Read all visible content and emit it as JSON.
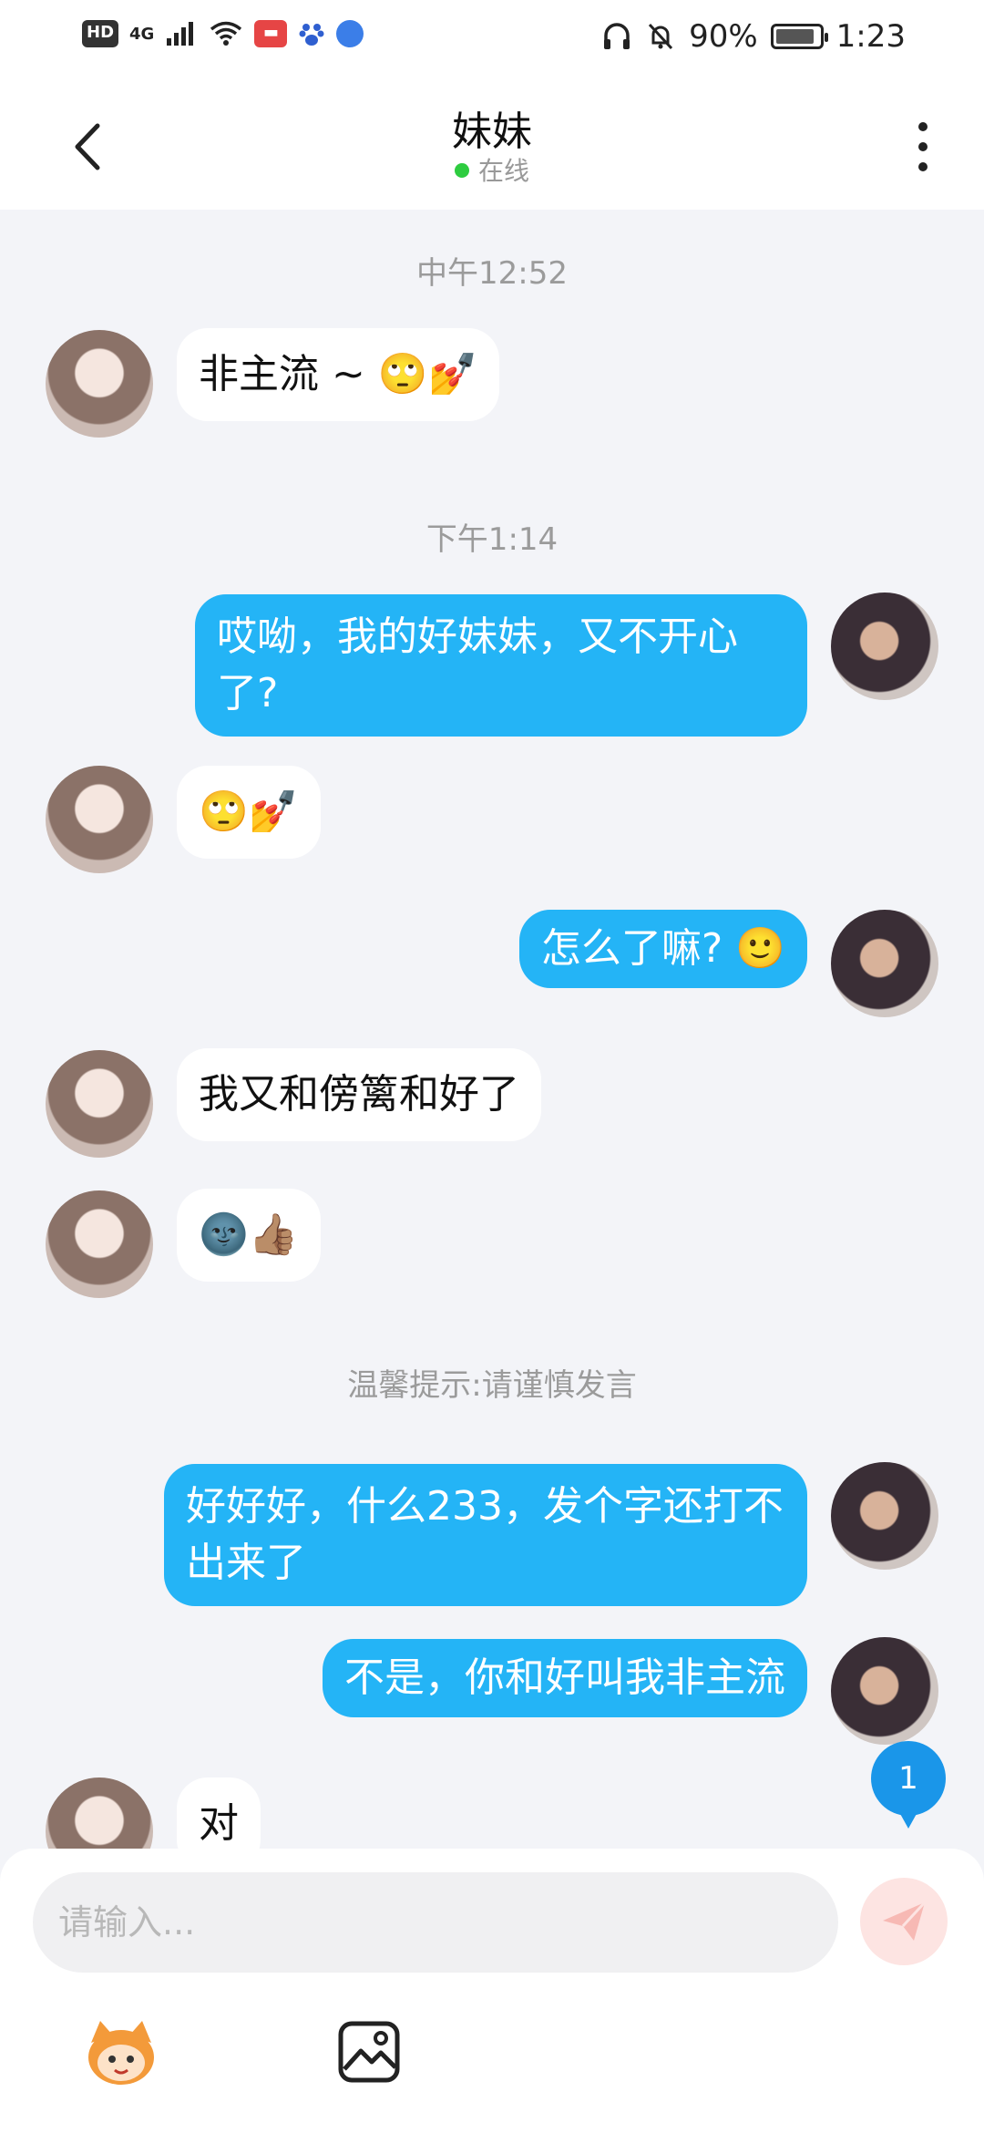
{
  "status_bar": {
    "hd": "HD",
    "network": "4G",
    "battery_level": "90%",
    "battery_fraction": 0.9,
    "time": "1:23"
  },
  "header": {
    "title": "妹妹",
    "status": "在线"
  },
  "messages": {
    "ts1": "中午12:52",
    "m1": "非主流 ~ 🙄💅",
    "ts2": "下午1:14",
    "m2": "哎呦，我的好妹妹，又不开心了?",
    "m3": "🙄💅",
    "m4": "怎么了嘛? 🙂",
    "m5": "我又和傍篱和好了",
    "m6": "🌚👍🏽",
    "notice": "温馨提示:请谨慎发言",
    "m7": "好好好，什么233，发个字还打不出来了",
    "m8": "不是，你和好叫我非主流",
    "m9": "对"
  },
  "unread_count": "1",
  "input": {
    "placeholder": "请输入..."
  },
  "colors": {
    "outgoing_bubble": "#24b4f6",
    "incoming_bubble": "#ffffff",
    "background": "#f3f4f8",
    "online_dot": "#2ecc40",
    "unread_badge": "#1a96e9"
  },
  "icons": {
    "back": "back-arrow-icon",
    "more": "more-vertical-icon",
    "send": "send-icon",
    "mascot": "mascot-sticker-icon",
    "image": "image-icon"
  }
}
